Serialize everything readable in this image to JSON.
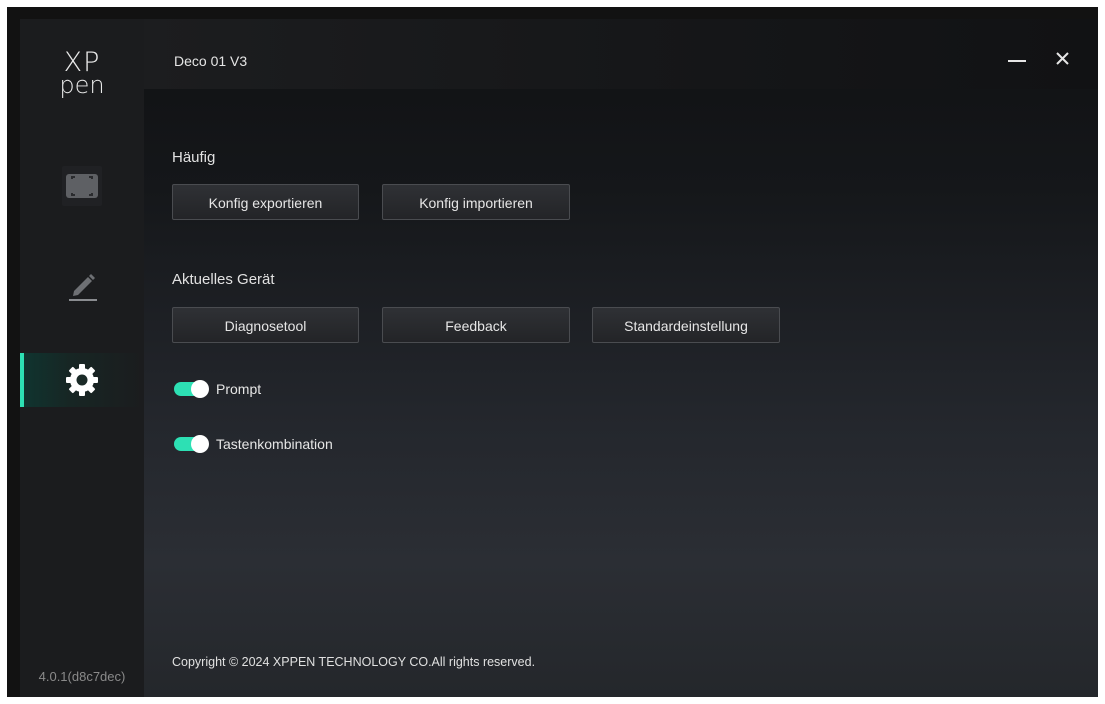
{
  "app": {
    "logo_top": "XP",
    "logo_bottom": "pen",
    "device_name": "Deco 01 V3",
    "version": "4.0.1(d8c7dec)"
  },
  "sidebar": {
    "items": [
      {
        "name": "work-area-icon",
        "active": false
      },
      {
        "name": "pen-icon",
        "active": false
      },
      {
        "name": "settings-gear-icon",
        "active": true
      }
    ]
  },
  "sections": {
    "frequent": {
      "label": "Häufig",
      "buttons": [
        "Konfig exportieren",
        "Konfig importieren"
      ]
    },
    "current_device": {
      "label": "Aktuelles Gerät",
      "buttons": [
        "Diagnosetool",
        "Feedback",
        "Standardeinstellung"
      ]
    }
  },
  "toggles": [
    {
      "label": "Prompt",
      "on": true
    },
    {
      "label": "Tastenkombination",
      "on": true
    }
  ],
  "footer": {
    "copyright": "Copyright © 2024  XPPEN TECHNOLOGY CO.All rights reserved."
  },
  "colors": {
    "accent": "#2de0b4",
    "background": "#121212",
    "sidebar": "#1b1c1e"
  }
}
